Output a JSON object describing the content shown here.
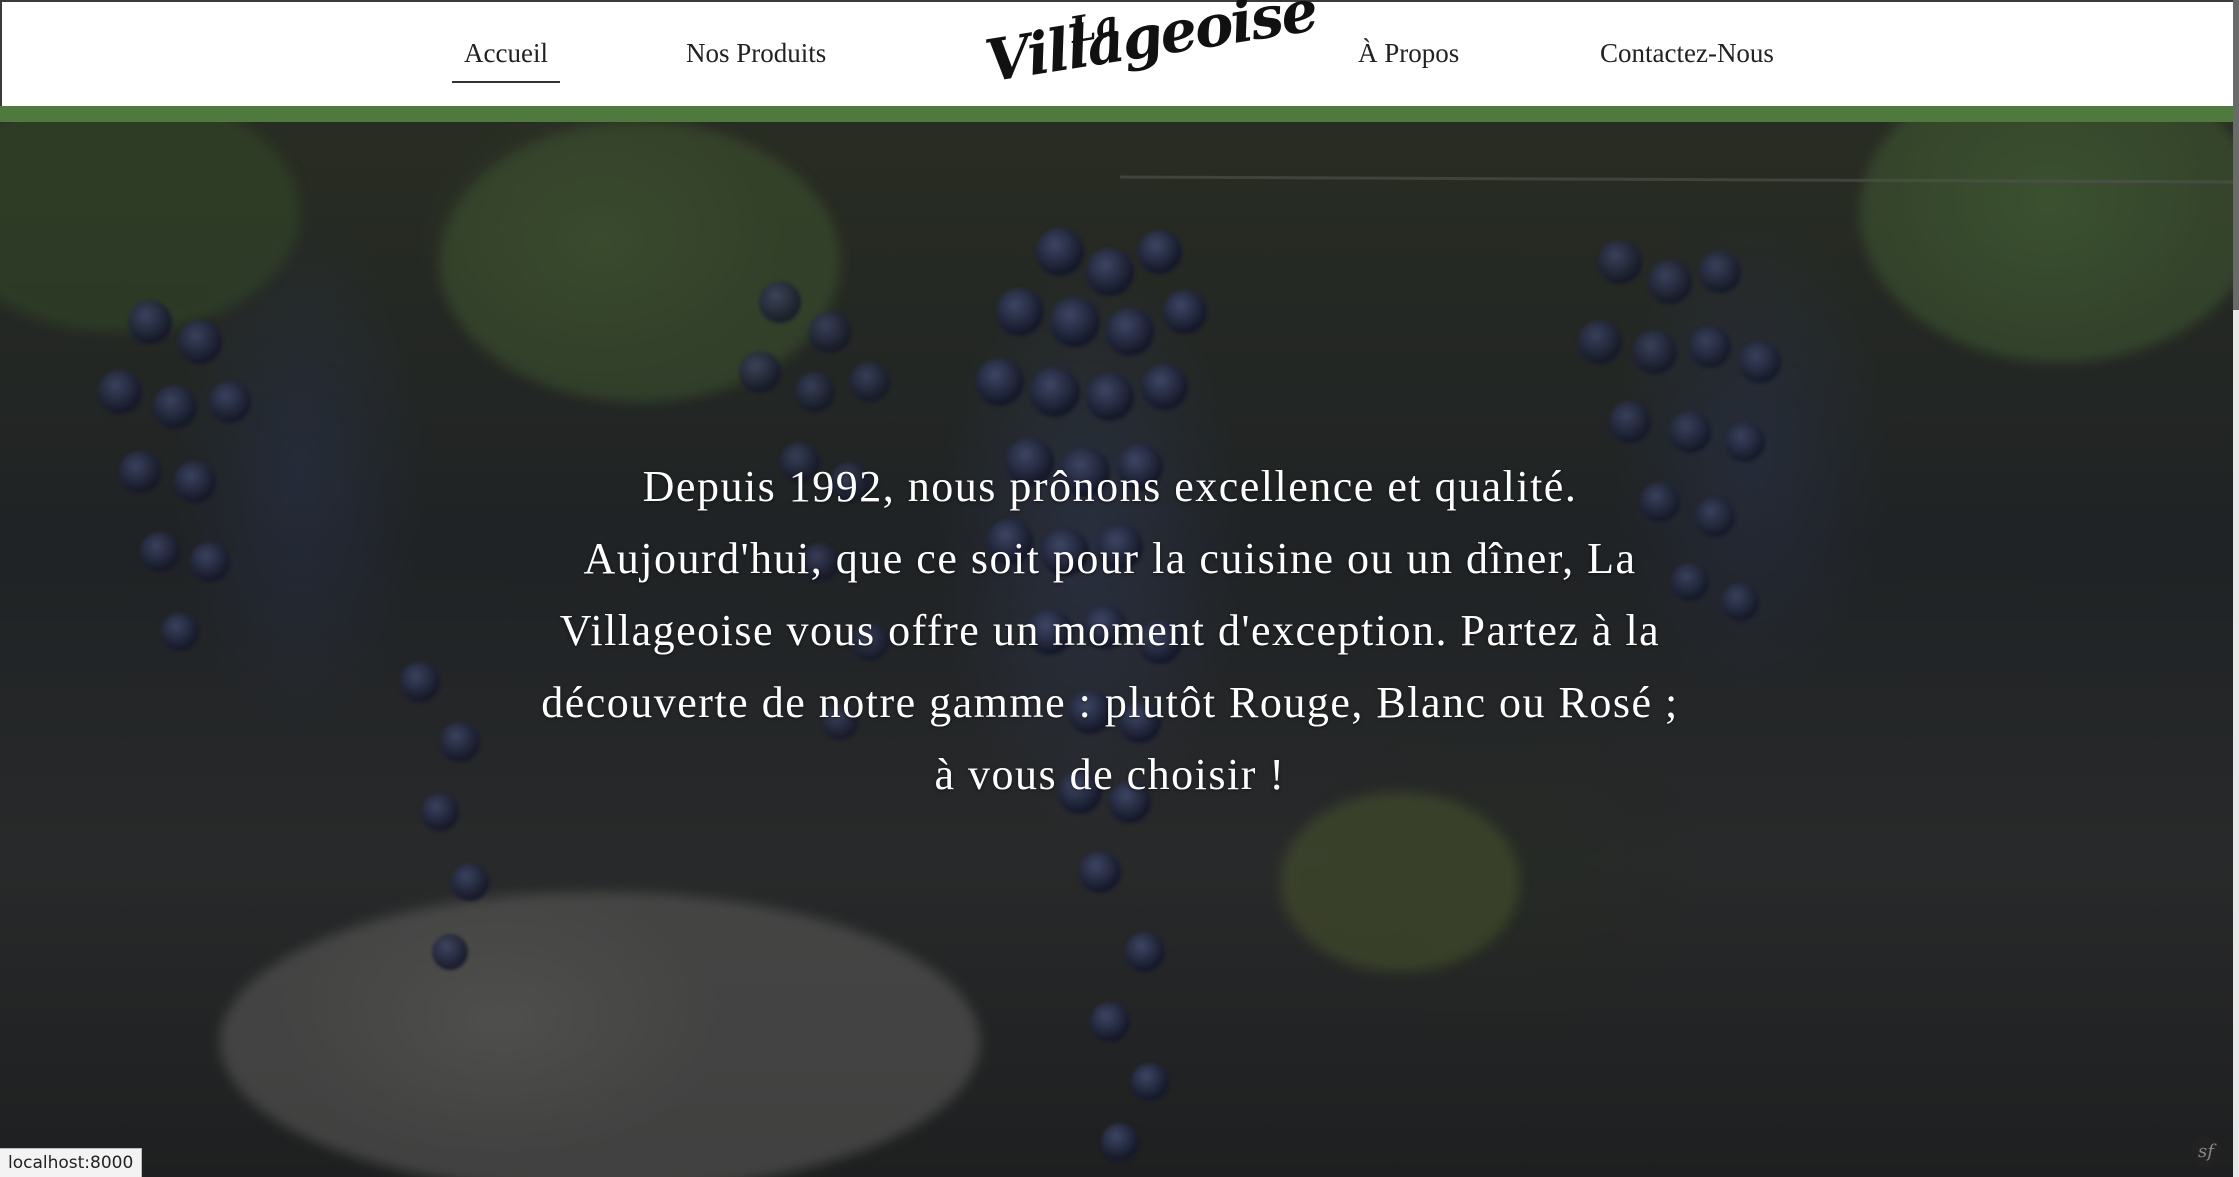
{
  "nav": {
    "items": [
      {
        "label": "Accueil",
        "active": true
      },
      {
        "label": "Nos Produits",
        "active": false
      },
      {
        "label": "À Propos",
        "active": false
      },
      {
        "label": "Contactez-Nous",
        "active": false
      }
    ]
  },
  "logo": {
    "line1": "La",
    "line2": "Villageoise"
  },
  "hero": {
    "text": "Depuis 1992, nous prônons excellence et qualité. Aujourd'hui, que ce soit pour la cuisine ou un dîner, La Villageoise vous offre un moment d'exception. Partez à la découverte de notre gamme : plutôt Rouge, Blanc ou Rosé ; à vous de choisir !"
  },
  "status": {
    "url": "localhost:8000"
  },
  "debug": {
    "badge": "sf"
  },
  "colors": {
    "accent": "#4f7a3e",
    "header_bg": "#ffffff"
  }
}
